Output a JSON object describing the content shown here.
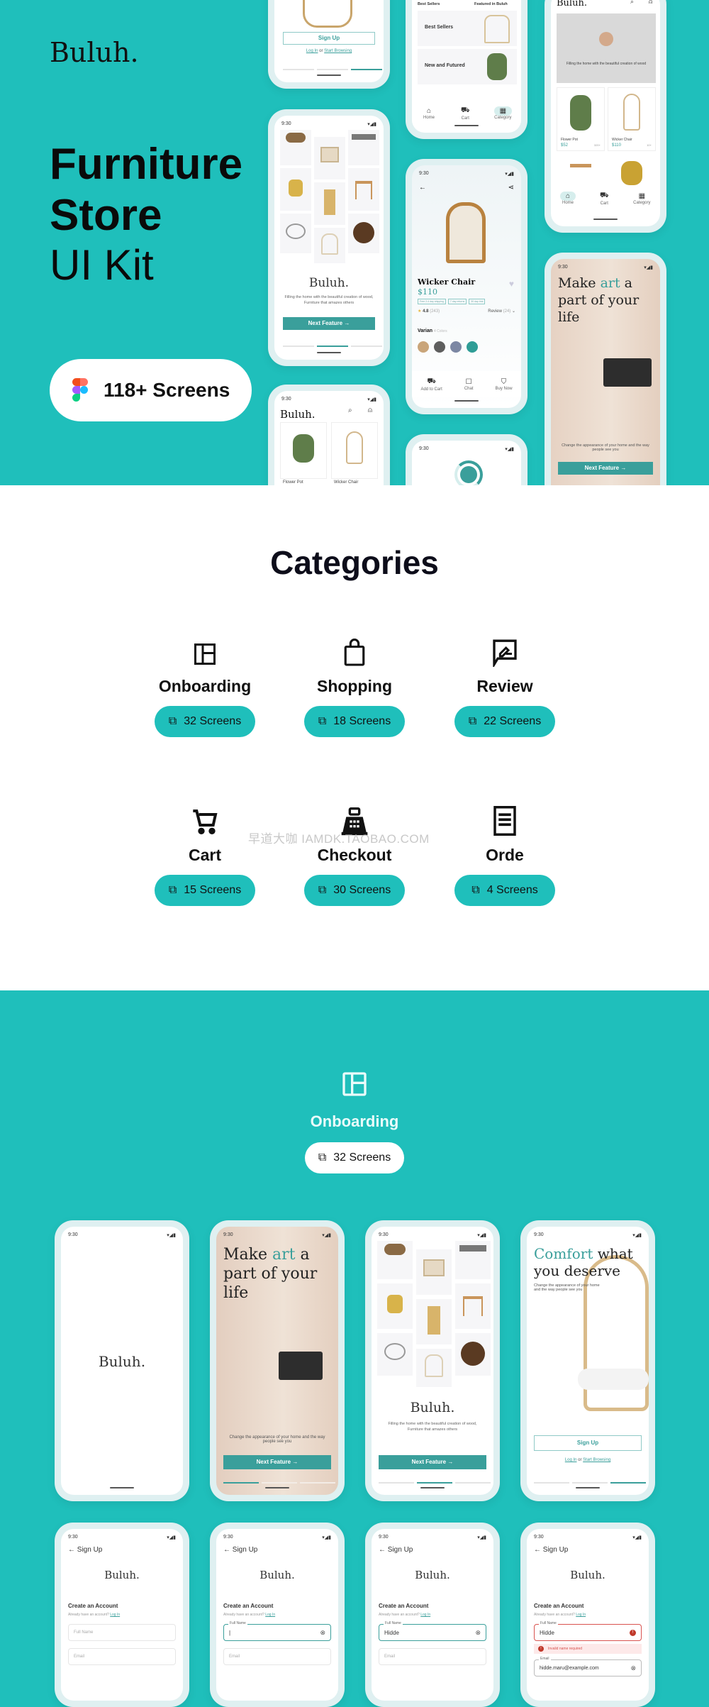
{
  "hero": {
    "brand": "Buluh.",
    "title_line1": "Furniture",
    "title_line2": "Store",
    "title_line3": "UI Kit",
    "screens_badge": "118+ Screens",
    "figma_colors": [
      "#f24e1e",
      "#ff7262",
      "#a259ff",
      "#1abcfe",
      "#0acf83"
    ]
  },
  "previews": {
    "status_time": "9:30",
    "signup_button": "Sign Up",
    "login_link": "Log In",
    "or_text": "or",
    "browse_link": "Start Browsing",
    "category_labels": [
      "Best Sellers",
      "Featured in Buluh"
    ],
    "category_rows": [
      "Best Sellers",
      "New and Futured"
    ],
    "nav": [
      "Home",
      "Cart",
      "Category"
    ],
    "home_brand": "Buluh.",
    "banner_text": "Filling the home with the beautiful creation of wood",
    "products": [
      {
        "name": "Flower Pot",
        "price": "$52",
        "sold": "320+"
      },
      {
        "name": "Wicker Chair",
        "price": "$110",
        "sold": "10+"
      }
    ],
    "splash_brand": "Buluh.",
    "splash_tagline": "Filling the home with the beautiful creation of wood, Furniture that amazes others",
    "next_button": "Next Feature",
    "detail": {
      "name": "Wicker Chair",
      "price": "$110",
      "tags": [
        "Free 2-4 day shipping",
        "7 day returns",
        "30 day trial"
      ],
      "rating": "4.8",
      "rating_count": "(243)",
      "review_label": "Review",
      "review_count": "(24)",
      "variant_label": "Varian",
      "variant_count": "4 Colors",
      "variants": [
        "#c9a57a",
        "#5e5e5e",
        "#7c87a3",
        "#2f9d96"
      ],
      "actions": [
        "Add to Cart",
        "Chat",
        "Buy Now"
      ]
    },
    "art": {
      "pre": "Make ",
      "accent": "art",
      "post": " a part of your life",
      "subtitle": "Change the appearance of your home and the way people see you"
    }
  },
  "categories": {
    "title": "Categories",
    "items": [
      {
        "name": "Onboarding",
        "count": "32 Screens",
        "icon": "layout-icon"
      },
      {
        "name": "Shopping",
        "count": "18 Screens",
        "icon": "shopping-bag-icon"
      },
      {
        "name": "Review",
        "count": "22 Screens",
        "icon": "review-icon"
      },
      {
        "name": "Cart",
        "count": "15 Screens",
        "icon": "cart-icon"
      },
      {
        "name": "Checkout",
        "count": "30 Screens",
        "icon": "cash-register-icon"
      },
      {
        "name": "Orde",
        "count": "4 Screens",
        "icon": "receipt-icon"
      }
    ],
    "watermark": "早道大咖  IAMDK.TAOBAO.COM"
  },
  "onboarding": {
    "title": "Onboarding",
    "count": "32 Screens",
    "screens": {
      "splash_brand": "Buluh.",
      "comfort_accent": "Comfort",
      "comfort_rest": " what you deserve",
      "comfort_sub": "Change the appearance of your home and the way people see you"
    },
    "signup": {
      "header": "Sign Up",
      "brand": "Buluh.",
      "heading": "Create an Account",
      "already": "Already have an account?",
      "login": "Log In",
      "fullname_label": "Full Name",
      "email_label": "Email",
      "name_value": "Hidde",
      "email_value": "hidde.maru@example.com",
      "error_text": "Invalid name required"
    }
  }
}
